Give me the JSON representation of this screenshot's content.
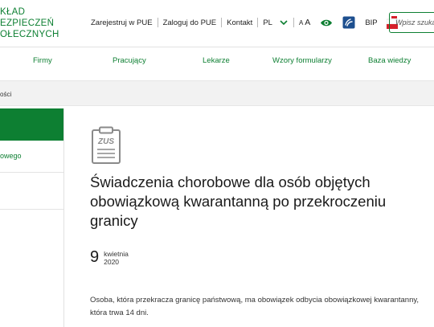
{
  "logo": {
    "lines": [
      "KŁAD",
      "EZPIECZEŃ",
      "OŁECZNYCH"
    ]
  },
  "utility": {
    "register": "Zarejestruj w PUE",
    "login": "Zaloguj do PUE",
    "contact": "Kontakt",
    "language": "PL",
    "font_small": "A",
    "font_big": "A",
    "bip": "BIP"
  },
  "search": {
    "placeholder": "Wpisz szukan"
  },
  "nav": [
    {
      "label": "Firmy"
    },
    {
      "label": "Pracujący"
    },
    {
      "label": "Lekarze"
    },
    {
      "label": "Wzory formularzy"
    },
    {
      "label": "Baza wiedzy"
    }
  ],
  "breadcrumb": {
    "text": "ości"
  },
  "sidebar": {
    "items": [
      {
        "label": "owego"
      }
    ]
  },
  "article": {
    "icon": "zus-document-icon",
    "title": "Świadczenia chorobowe dla osób objętych obowiązkową kwarantanną po przekroczeniu granicy",
    "date": {
      "day": "9",
      "month": "kwietnia",
      "year": "2020"
    },
    "lead": "Osoba, która przekracza granicę państwową, ma obowiązek odbycia obowiązkowej kwarantanny, która trwa 14 dni."
  },
  "colors": {
    "brand_green": "#0d7f32",
    "flag_red": "#d6202b"
  }
}
